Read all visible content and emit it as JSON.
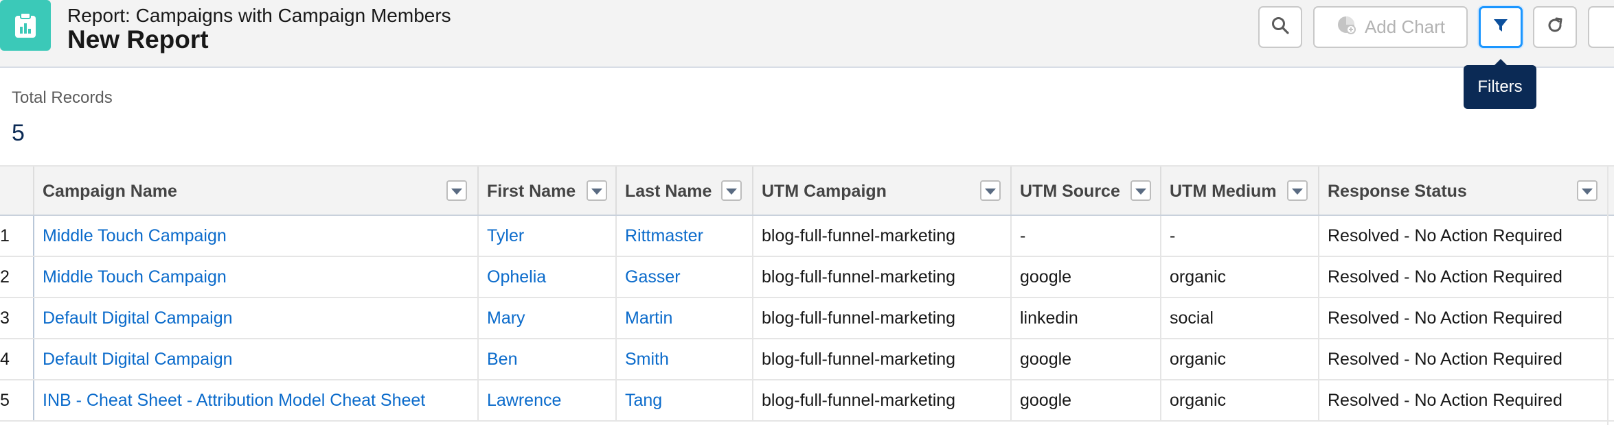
{
  "header": {
    "supertitle": "Report: Campaigns with Campaign Members",
    "title": "New Report",
    "add_chart_label": "Add Chart",
    "tooltip": "Filters"
  },
  "summary": {
    "total_label": "Total Records",
    "total_value": "5"
  },
  "table": {
    "columns": [
      "Campaign Name",
      "First Name",
      "Last Name",
      "UTM Campaign",
      "UTM Source",
      "UTM Medium",
      "Response Status"
    ],
    "rows": [
      {
        "n": "1",
        "campaign": "Middle Touch Campaign",
        "first": "Tyler",
        "last": "Rittmaster",
        "utm_campaign": "blog-full-funnel-marketing",
        "utm_source": "-",
        "utm_medium": "-",
        "status": "Resolved - No Action Required"
      },
      {
        "n": "2",
        "campaign": "Middle Touch Campaign",
        "first": "Ophelia",
        "last": "Gasser",
        "utm_campaign": "blog-full-funnel-marketing",
        "utm_source": "google",
        "utm_medium": "organic",
        "status": "Resolved - No Action Required"
      },
      {
        "n": "3",
        "campaign": "Default Digital Campaign",
        "first": "Mary",
        "last": "Martin",
        "utm_campaign": "blog-full-funnel-marketing",
        "utm_source": "linkedin",
        "utm_medium": "social",
        "status": "Resolved - No Action Required"
      },
      {
        "n": "4",
        "campaign": "Default Digital Campaign",
        "first": "Ben",
        "last": "Smith",
        "utm_campaign": "blog-full-funnel-marketing",
        "utm_source": "google",
        "utm_medium": "organic",
        "status": "Resolved - No Action Required"
      },
      {
        "n": "5",
        "campaign": "INB - Cheat Sheet - Attribution Model Cheat Sheet",
        "first": "Lawrence",
        "last": "Tang",
        "utm_campaign": "blog-full-funnel-marketing",
        "utm_source": "google",
        "utm_medium": "organic",
        "status": "Resolved - No Action Required"
      }
    ]
  },
  "icons": {
    "report": "report-icon",
    "search": "search-icon",
    "chart": "chart-icon",
    "filter": "filter-icon",
    "refresh": "refresh-icon"
  },
  "colors": {
    "report_icon_bg": "#3bc9b8",
    "link": "#0b6bcb",
    "tooltip_bg": "#0b2a55",
    "focus": "#1b96ff"
  }
}
